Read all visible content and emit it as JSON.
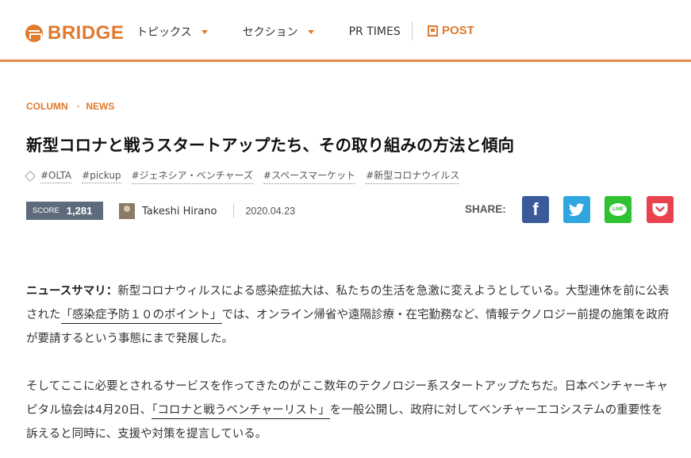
{
  "header": {
    "logo_text": "BRIDGE",
    "nav": [
      {
        "label": "トピックス",
        "has_caret": true
      },
      {
        "label": "セクション",
        "has_caret": true
      },
      {
        "label": "PR TIMES",
        "has_caret": false
      }
    ],
    "post_label": "POST",
    "accent_color": "#e07a2e"
  },
  "article": {
    "breadcrumbs": [
      "COLUMN",
      "NEWS"
    ],
    "title": "新型コロナと戦うスタートアップたち、その取り組みの方法と傾向",
    "tags": [
      "#OLTA",
      "#pickup",
      "#ジェネシア・ベンチャーズ",
      "#スペースマーケット",
      "#新型コロナウイルス"
    ],
    "score_label": "SCORE",
    "score_value": "1,281",
    "author": "Takeshi Hirano",
    "date": "2020.04.23",
    "share_label": "SHARE:",
    "share_buttons": [
      {
        "name": "facebook",
        "glyph": "f",
        "color": "#3b5a9a"
      },
      {
        "name": "twitter",
        "color": "#2fa6e0"
      },
      {
        "name": "line",
        "glyph": "LINE",
        "color": "#2ec130"
      },
      {
        "name": "pocket",
        "color": "#e8424f"
      }
    ],
    "paragraph1": {
      "lead": "ニュースサマリ：",
      "text_a": "新型コロナウィルスによる感染症拡大は、私たちの生活を急激に変えようとしている。大型連休を前に公表された",
      "link": "「感染症予防１０のポイント」",
      "text_b": "では、オンライン帰省や遠隔診療・在宅勤務など、情報テクノロジー前提の施策を政府が要請するという事態にまで発展した。"
    },
    "paragraph2": {
      "text_a": "そしてここに必要とされるサービスを作ってきたのがここ数年のテクノロジー系スタートアップたちだ。日本ベンチャーキャピタル協会は4月20日、",
      "link": "「コロナと戦うベンチャーリスト」",
      "text_b": "を一般公開し、政府に対してベンチャーエコシステムの重要性を訴えると同時に、支援や対策を提言している。"
    }
  }
}
